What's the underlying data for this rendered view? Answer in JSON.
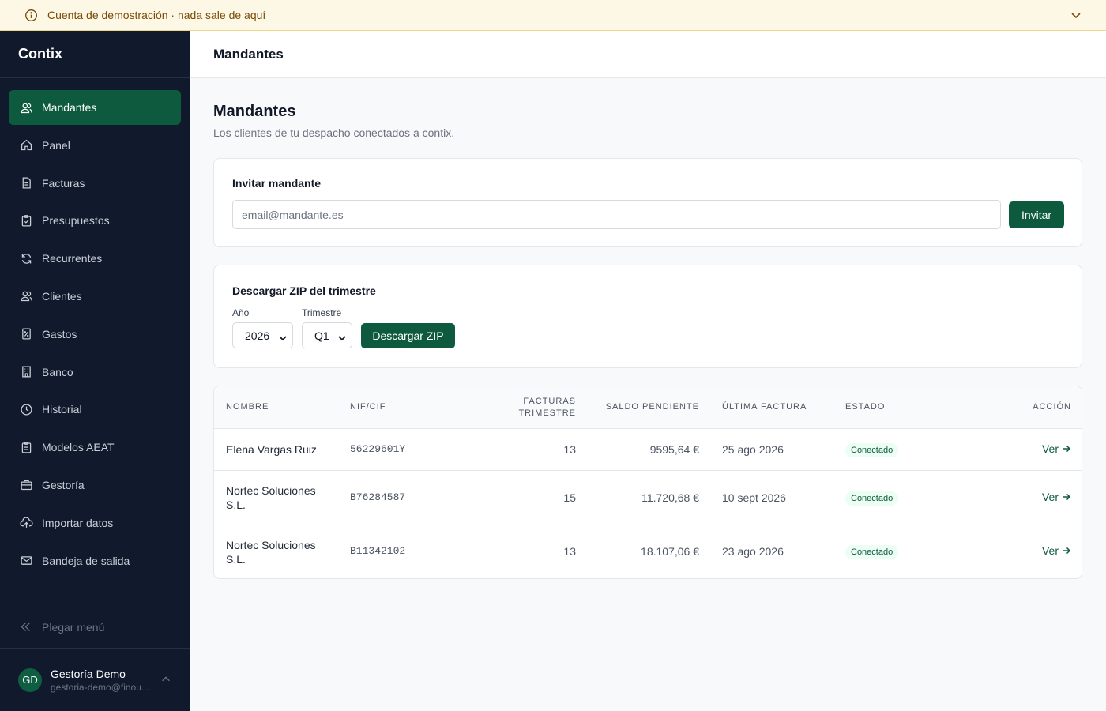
{
  "banner": {
    "text": "Cuenta de demostración · nada sale de aquí"
  },
  "sidebar": {
    "brand": "Contix",
    "items": [
      {
        "label": "Mandantes",
        "icon": "users-icon"
      },
      {
        "label": "Panel",
        "icon": "home-icon"
      },
      {
        "label": "Facturas",
        "icon": "document-icon"
      },
      {
        "label": "Presupuestos",
        "icon": "clipboard-check-icon"
      },
      {
        "label": "Recurrentes",
        "icon": "refresh-icon"
      },
      {
        "label": "Clientes",
        "icon": "users-icon"
      },
      {
        "label": "Gastos",
        "icon": "receipt-icon"
      },
      {
        "label": "Banco",
        "icon": "building-icon"
      },
      {
        "label": "Historial",
        "icon": "clock-icon"
      },
      {
        "label": "Modelos AEAT",
        "icon": "clipboard-icon"
      },
      {
        "label": "Gestoría",
        "icon": "briefcase-icon"
      },
      {
        "label": "Importar datos",
        "icon": "cloud-upload-icon"
      },
      {
        "label": "Bandeja de salida",
        "icon": "mail-icon"
      }
    ],
    "collapse_label": "Plegar menú",
    "user": {
      "initials": "GD",
      "name": "Gestoría Demo",
      "email": "gestoria-demo@finou..."
    }
  },
  "topbar": {
    "title": "Mandantes"
  },
  "page": {
    "title": "Mandantes",
    "subtitle": "Los clientes de tu despacho conectados a contix."
  },
  "invite": {
    "title": "Invitar mandante",
    "placeholder": "email@mandante.es",
    "button": "Invitar"
  },
  "zip": {
    "title": "Descargar ZIP del trimestre",
    "year_label": "Año",
    "year_value": "2026",
    "quarter_label": "Trimestre",
    "quarter_value": "Q1",
    "button": "Descargar ZIP"
  },
  "table": {
    "headers": {
      "nombre": "NOMBRE",
      "nif": "NIF/CIF",
      "facturas_1": "FACTURAS",
      "facturas_2": "TRIMESTRE",
      "saldo": "SALDO PENDIENTE",
      "ultima": "ÚLTIMA FACTURA",
      "estado": "ESTADO",
      "accion": "ACCIÓN"
    },
    "rows": [
      {
        "nombre": "Elena Vargas Ruiz",
        "nif": "56229601Y",
        "facturas": "13",
        "saldo": "9595,64 €",
        "ultima": "25 ago 2026",
        "estado": "Conectado",
        "accion": "Ver"
      },
      {
        "nombre": "Nortec Soluciones S.L.",
        "nif": "B76284587",
        "facturas": "15",
        "saldo": "11.720,68 €",
        "ultima": "10 sept 2026",
        "estado": "Conectado",
        "accion": "Ver"
      },
      {
        "nombre": "Nortec Soluciones S.L.",
        "nif": "B11342102",
        "facturas": "13",
        "saldo": "18.107,06 €",
        "ultima": "23 ago 2026",
        "estado": "Conectado",
        "accion": "Ver"
      }
    ]
  },
  "colors": {
    "accent": "#0d5a3e",
    "sidebar_bg": "#111a2c",
    "banner_bg": "#fdf8e5",
    "banner_text": "#7a4a05"
  }
}
